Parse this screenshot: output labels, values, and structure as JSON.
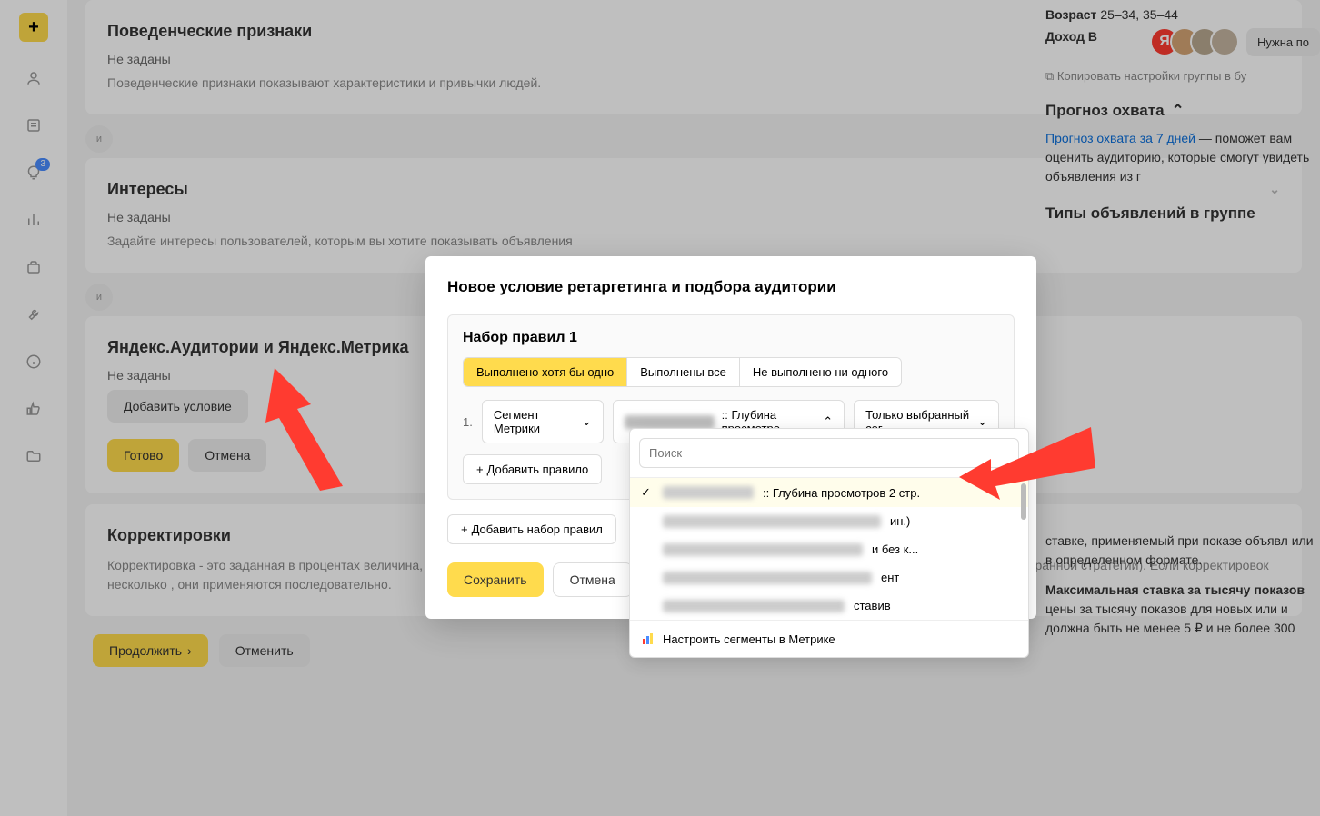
{
  "sidebar": {
    "plus": "+",
    "badge_value": "3"
  },
  "cards": {
    "behavioral": {
      "title": "Поведенческие признаки",
      "not_set": "Не заданы",
      "desc": "Поведенческие признаки показывают характеристики и привычки людей."
    },
    "divider": "и",
    "interests": {
      "title": "Интересы",
      "not_set": "Не заданы",
      "desc": "Задайте интересы пользователей, которым вы хотите показывать объявления"
    },
    "audiences": {
      "title": "Яндекс.Аудитории и Яндекс.Метрика",
      "not_set": "Не заданы",
      "add_cond": "Добавить условие",
      "ready": "Готово",
      "cancel": "Отмена"
    },
    "adjustments": {
      "title": "Корректировки",
      "desc": "Корректировка - это заданная в процентах величина, на которую повышается или понижается ставка за клик или ценность конверсии(в зависимости от выбранной стратегии). Если корректировок несколько , они применяются последовательно."
    }
  },
  "footer": {
    "continue": "Продолжить",
    "cancel": "Отменить"
  },
  "right": {
    "age_label": "Возраст",
    "age_value": "25–34, 35–44",
    "income_label": "Доход В",
    "copy": "Копировать настройки группы в бу",
    "forecast_title": "Прогноз охвата",
    "forecast_link": "Прогноз охвата за 7 дней",
    "forecast_text": " — поможет вам оценить аудиторию, которые смогут увидеть объявления из г",
    "types_title": "Типы объявлений в группе",
    "bid_text": "ставке, применяемый при показе объявл или в определенном формате.",
    "max_bid_label": "Максимальная ставка за тысячу показов",
    "max_bid_text": "цены за тысячу показов для новых или и должна быть не менее 5 ₽ и не более 300",
    "help_btn": "Нужна по"
  },
  "modal": {
    "title": "Новое условие ретаргетинга и подбора аудитории",
    "ruleset_title": "Набор правил 1",
    "seg1": "Выполнено хотя бы одно",
    "seg2": "Выполнены все",
    "seg3": "Не выполнено ни одного",
    "rule_num": "1.",
    "select1": "Сегмент Метрики",
    "select2_suffix": ":: Глубина просмотро...",
    "select3": "Только выбранный сег...",
    "add_rule": "Добавить правило",
    "add_ruleset": "Добавить набор правил",
    "save": "Сохранить",
    "cancel": "Отмена"
  },
  "dropdown": {
    "search_placeholder": "Поиск",
    "item1_suffix": " :: Глубина просмотров 2 стр.",
    "item2_suffix": "ин.)",
    "item3_suffix": "и без к...",
    "item4_suffix": "ент",
    "item5_suffix": "ставив",
    "footer": "Настроить сегменты в Метрике"
  }
}
